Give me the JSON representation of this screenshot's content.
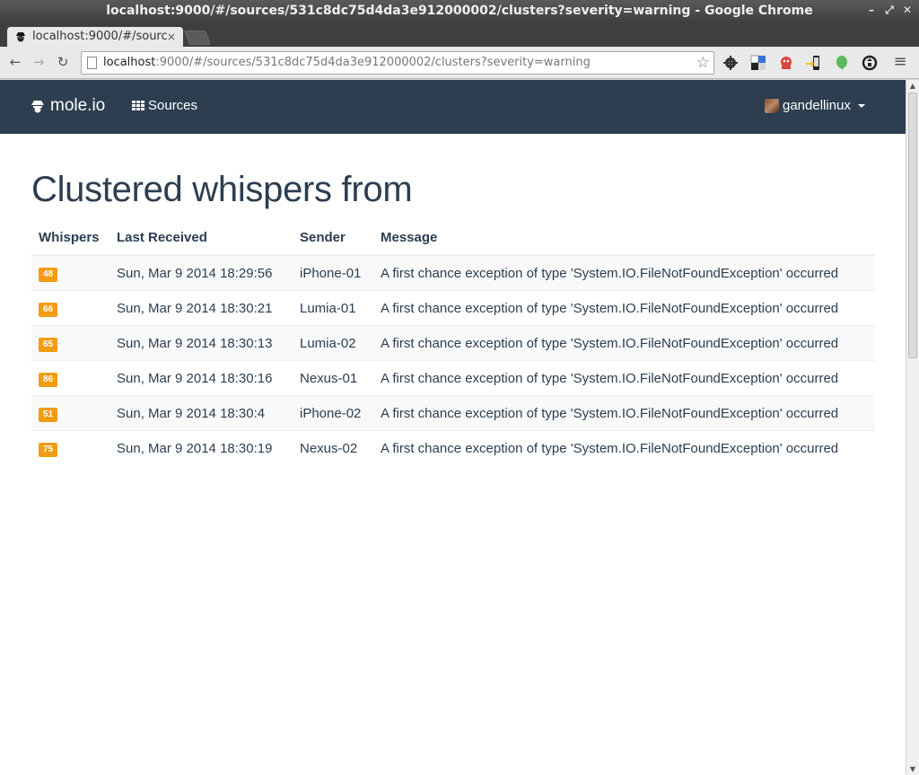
{
  "window": {
    "title": "localhost:9000/#/sources/531c8dc75d4da3e912000002/clusters?severity=warning - Google Chrome"
  },
  "tab": {
    "label": "localhost:9000/#/sourc",
    "close": "×"
  },
  "address_bar": {
    "host": "localhost",
    "rest": ":9000/#/sources/531c8dc75d4da3e912000002/clusters?severity=warning"
  },
  "navbar": {
    "brand": "mole.io",
    "sources_label": "Sources",
    "user": "gandellinux"
  },
  "page": {
    "title": "Clustered whispers from"
  },
  "table": {
    "headers": [
      "Whispers",
      "Last Received",
      "Sender",
      "Message"
    ],
    "rows": [
      {
        "count": "48",
        "received": "Sun, Mar 9 2014 18:29:56",
        "sender": "iPhone-01",
        "message": "A first chance exception of type 'System.IO.FileNotFoundException' occurred"
      },
      {
        "count": "66",
        "received": "Sun, Mar 9 2014 18:30:21",
        "sender": "Lumia-01",
        "message": "A first chance exception of type 'System.IO.FileNotFoundException' occurred"
      },
      {
        "count": "65",
        "received": "Sun, Mar 9 2014 18:30:13",
        "sender": "Lumia-02",
        "message": "A first chance exception of type 'System.IO.FileNotFoundException' occurred"
      },
      {
        "count": "86",
        "received": "Sun, Mar 9 2014 18:30:16",
        "sender": "Nexus-01",
        "message": "A first chance exception of type 'System.IO.FileNotFoundException' occurred"
      },
      {
        "count": "51",
        "received": "Sun, Mar 9 2014 18:30:4",
        "sender": "iPhone-02",
        "message": "A first chance exception of type 'System.IO.FileNotFoundException' occurred"
      },
      {
        "count": "75",
        "received": "Sun, Mar 9 2014 18:30:19",
        "sender": "Nexus-02",
        "message": "A first chance exception of type 'System.IO.FileNotFoundException' occurred"
      }
    ]
  },
  "colors": {
    "navbar_bg": "#2c3e50",
    "badge_warning": "#f39c12",
    "text_primary": "#2c3e50"
  },
  "icons": {
    "brand": "spy-icon",
    "sources": "grid-icon",
    "user": "avatar",
    "bookmark": "star-icon"
  }
}
